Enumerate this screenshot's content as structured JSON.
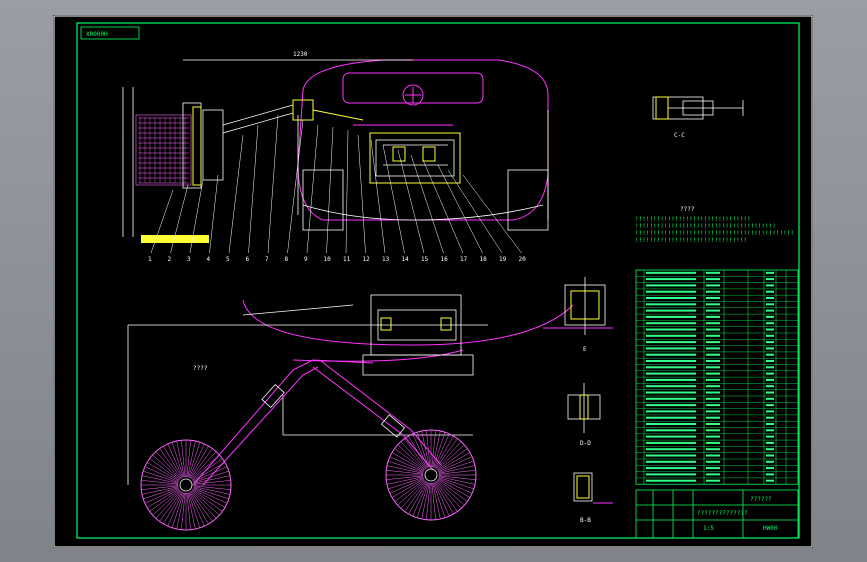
{
  "drawing": {
    "tag_label": "X0000H",
    "view_label": "C-C",
    "section_labels": [
      "E",
      "D-D",
      "B-B"
    ],
    "note_title": "????",
    "note_lines": [
      "!!!!!!!!!!!!!!!!!!!!!!!!!!!!!!!!",
      "!!!!!!!!!!!!!!!!!!!!!!!!!!!!!!!!!!!!!!!",
      "!!!!!!!!!!!!!!!!!!!!!!!!!!!!!!!!!!!!!!!!!!!!",
      "!!!!!!!!!!!!!!!!!!!!!!!!!!!!!!!"
    ],
    "part_numbers": [
      "1",
      "2",
      "3",
      "4",
      "5",
      "6",
      "7",
      "8",
      "9",
      "10",
      "11",
      "12",
      "13",
      "14",
      "15",
      "16",
      "17",
      "18",
      "19",
      "20"
    ],
    "top_dimension": "1230",
    "misc_label": "????"
  },
  "title_block": {
    "drawing_name": "??????",
    "code": "HW00",
    "company": "??????????????",
    "scale": "1:5"
  },
  "colors": {
    "frame": "#00ff66",
    "truck": "#ff33ff",
    "lines": "#ffffff",
    "brush": "#ff66ff",
    "accent": "#ffff33"
  }
}
